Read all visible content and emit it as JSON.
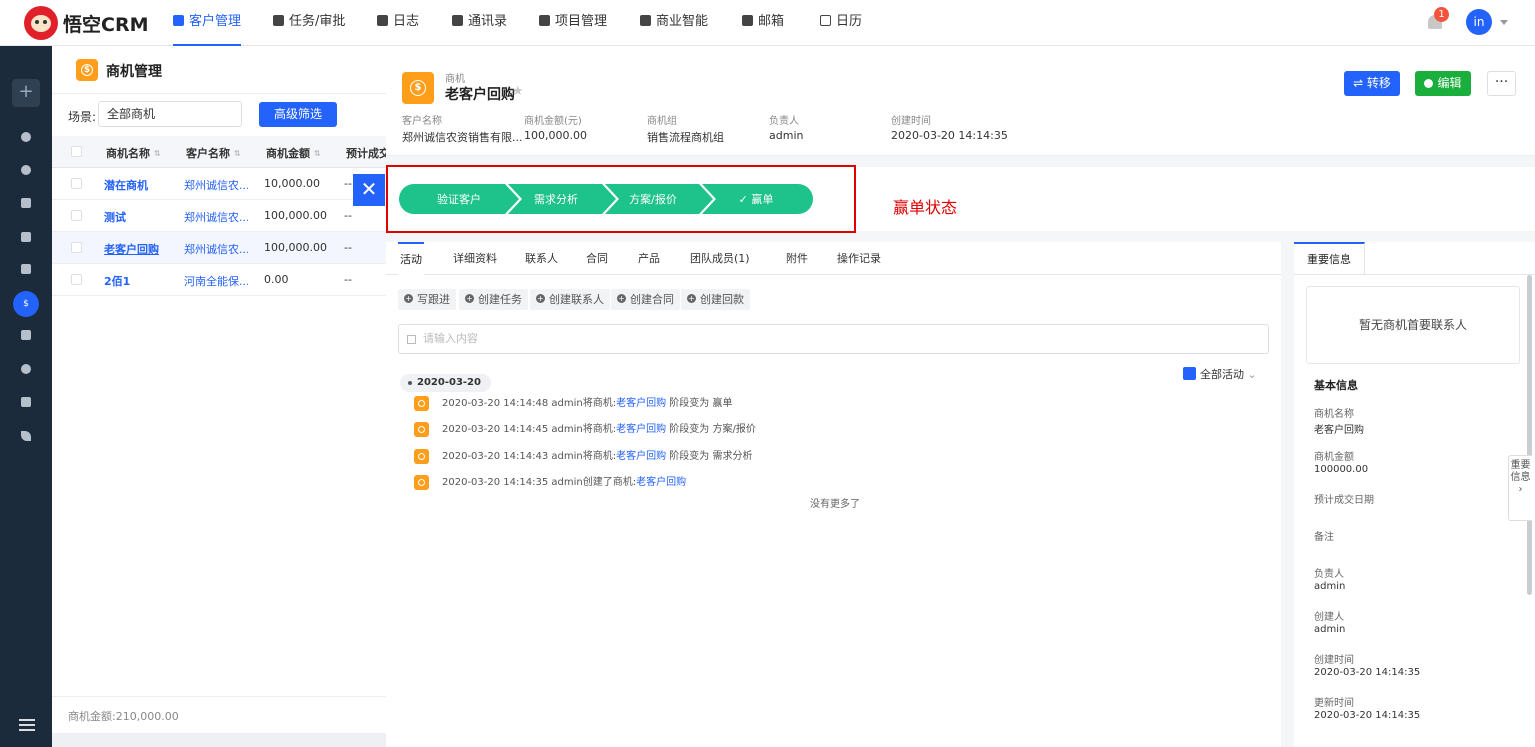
{
  "app": {
    "brand": "悟空CRM"
  },
  "nav": [
    {
      "label": "客户管理",
      "active": true
    },
    {
      "label": "任务/审批"
    },
    {
      "label": "日志"
    },
    {
      "label": "通讯录"
    },
    {
      "label": "项目管理"
    },
    {
      "label": "商业智能"
    },
    {
      "label": "邮箱"
    },
    {
      "label": "日历"
    }
  ],
  "user": {
    "notifications": "1",
    "avatar": "in"
  },
  "rail": {
    "add": "+",
    "active_symbol": "$"
  },
  "list": {
    "title": "商机管理",
    "scene_label": "场景:",
    "scene_value": "全部商机",
    "filter_button": "高级筛选",
    "columns": [
      "商机名称",
      "客户名称",
      "商机金额",
      "预计成交"
    ],
    "rows": [
      {
        "name": "潜在商机",
        "customer": "郑州诚信农...",
        "amount": "10,000.00",
        "date": "--"
      },
      {
        "name": "测试",
        "customer": "郑州诚信农...",
        "amount": "100,000.00",
        "date": "--"
      },
      {
        "name": "老客户回购",
        "customer": "郑州诚信农...",
        "amount": "100,000.00",
        "date": "--"
      },
      {
        "name": "2佰1",
        "customer": "河南全能保...",
        "amount": "0.00",
        "date": "--"
      }
    ],
    "total": "商机金额:210,000.00",
    "close": "✕"
  },
  "detail": {
    "type": "商机",
    "title": "老客户回购",
    "info": [
      {
        "label": "客户名称",
        "value": "郑州诚信农资销售有限..."
      },
      {
        "label": "商机金额(元)",
        "value": "100,000.00"
      },
      {
        "label": "商机组",
        "value": "销售流程商机组"
      },
      {
        "label": "负责人",
        "value": "admin"
      },
      {
        "label": "创建时间",
        "value": "2020-03-20 14:14:35"
      }
    ],
    "buttons": {
      "transfer": "⇌ 转移",
      "edit": "编辑",
      "more": "···"
    },
    "stages": [
      "验证客户",
      "需求分析",
      "方案/报价",
      "✓  赢单"
    ],
    "stage_annotation": "赢单状态",
    "colors": {
      "stage": "#1ec28b",
      "primary": "#2362fb",
      "success": "#1aae3d",
      "warning": "#ff9e1b",
      "annotation": "#e00000"
    }
  },
  "activity": {
    "tabs": [
      "活动",
      "详细资料",
      "联系人",
      "合同",
      "产品",
      "团队成员(1)",
      "附件",
      "操作记录"
    ],
    "actions": [
      "写跟进",
      "创建任务",
      "创建联系人",
      "创建合同",
      "创建回款"
    ],
    "input_placeholder": "请输入内容",
    "date": "2020-03-20",
    "filter": "全部活动",
    "logs": [
      {
        "pre": "2020-03-20 14:14:48 admin将商机:",
        "link": "老客户回购",
        "post": " 阶段变为 赢单"
      },
      {
        "pre": "2020-03-20 14:14:45 admin将商机:",
        "link": "老客户回购",
        "post": " 阶段变为 方案/报价"
      },
      {
        "pre": "2020-03-20 14:14:43 admin将商机:",
        "link": "老客户回购",
        "post": " 阶段变为 需求分析"
      },
      {
        "pre": "2020-03-20 14:14:35 admin创建了商机:",
        "link": "老客户回购",
        "post": ""
      }
    ],
    "no_more": "没有更多了"
  },
  "side": {
    "tab": "重要信息",
    "contact_empty": "暂无商机首要联系人",
    "basic_title": "基本信息",
    "fields": [
      {
        "k": "商机名称",
        "v": "老客户回购"
      },
      {
        "k": "商机金额",
        "v": "100000.00"
      },
      {
        "k": "预计成交日期",
        "v": ""
      },
      {
        "k": "备注",
        "v": ""
      },
      {
        "k": "负责人",
        "v": "admin"
      },
      {
        "k": "创建人",
        "v": "admin"
      },
      {
        "k": "创建时间",
        "v": "2020-03-20 14:14:35"
      },
      {
        "k": "更新时间",
        "v": "2020-03-20 14:14:35"
      }
    ],
    "handle": "重要信息 ›"
  }
}
